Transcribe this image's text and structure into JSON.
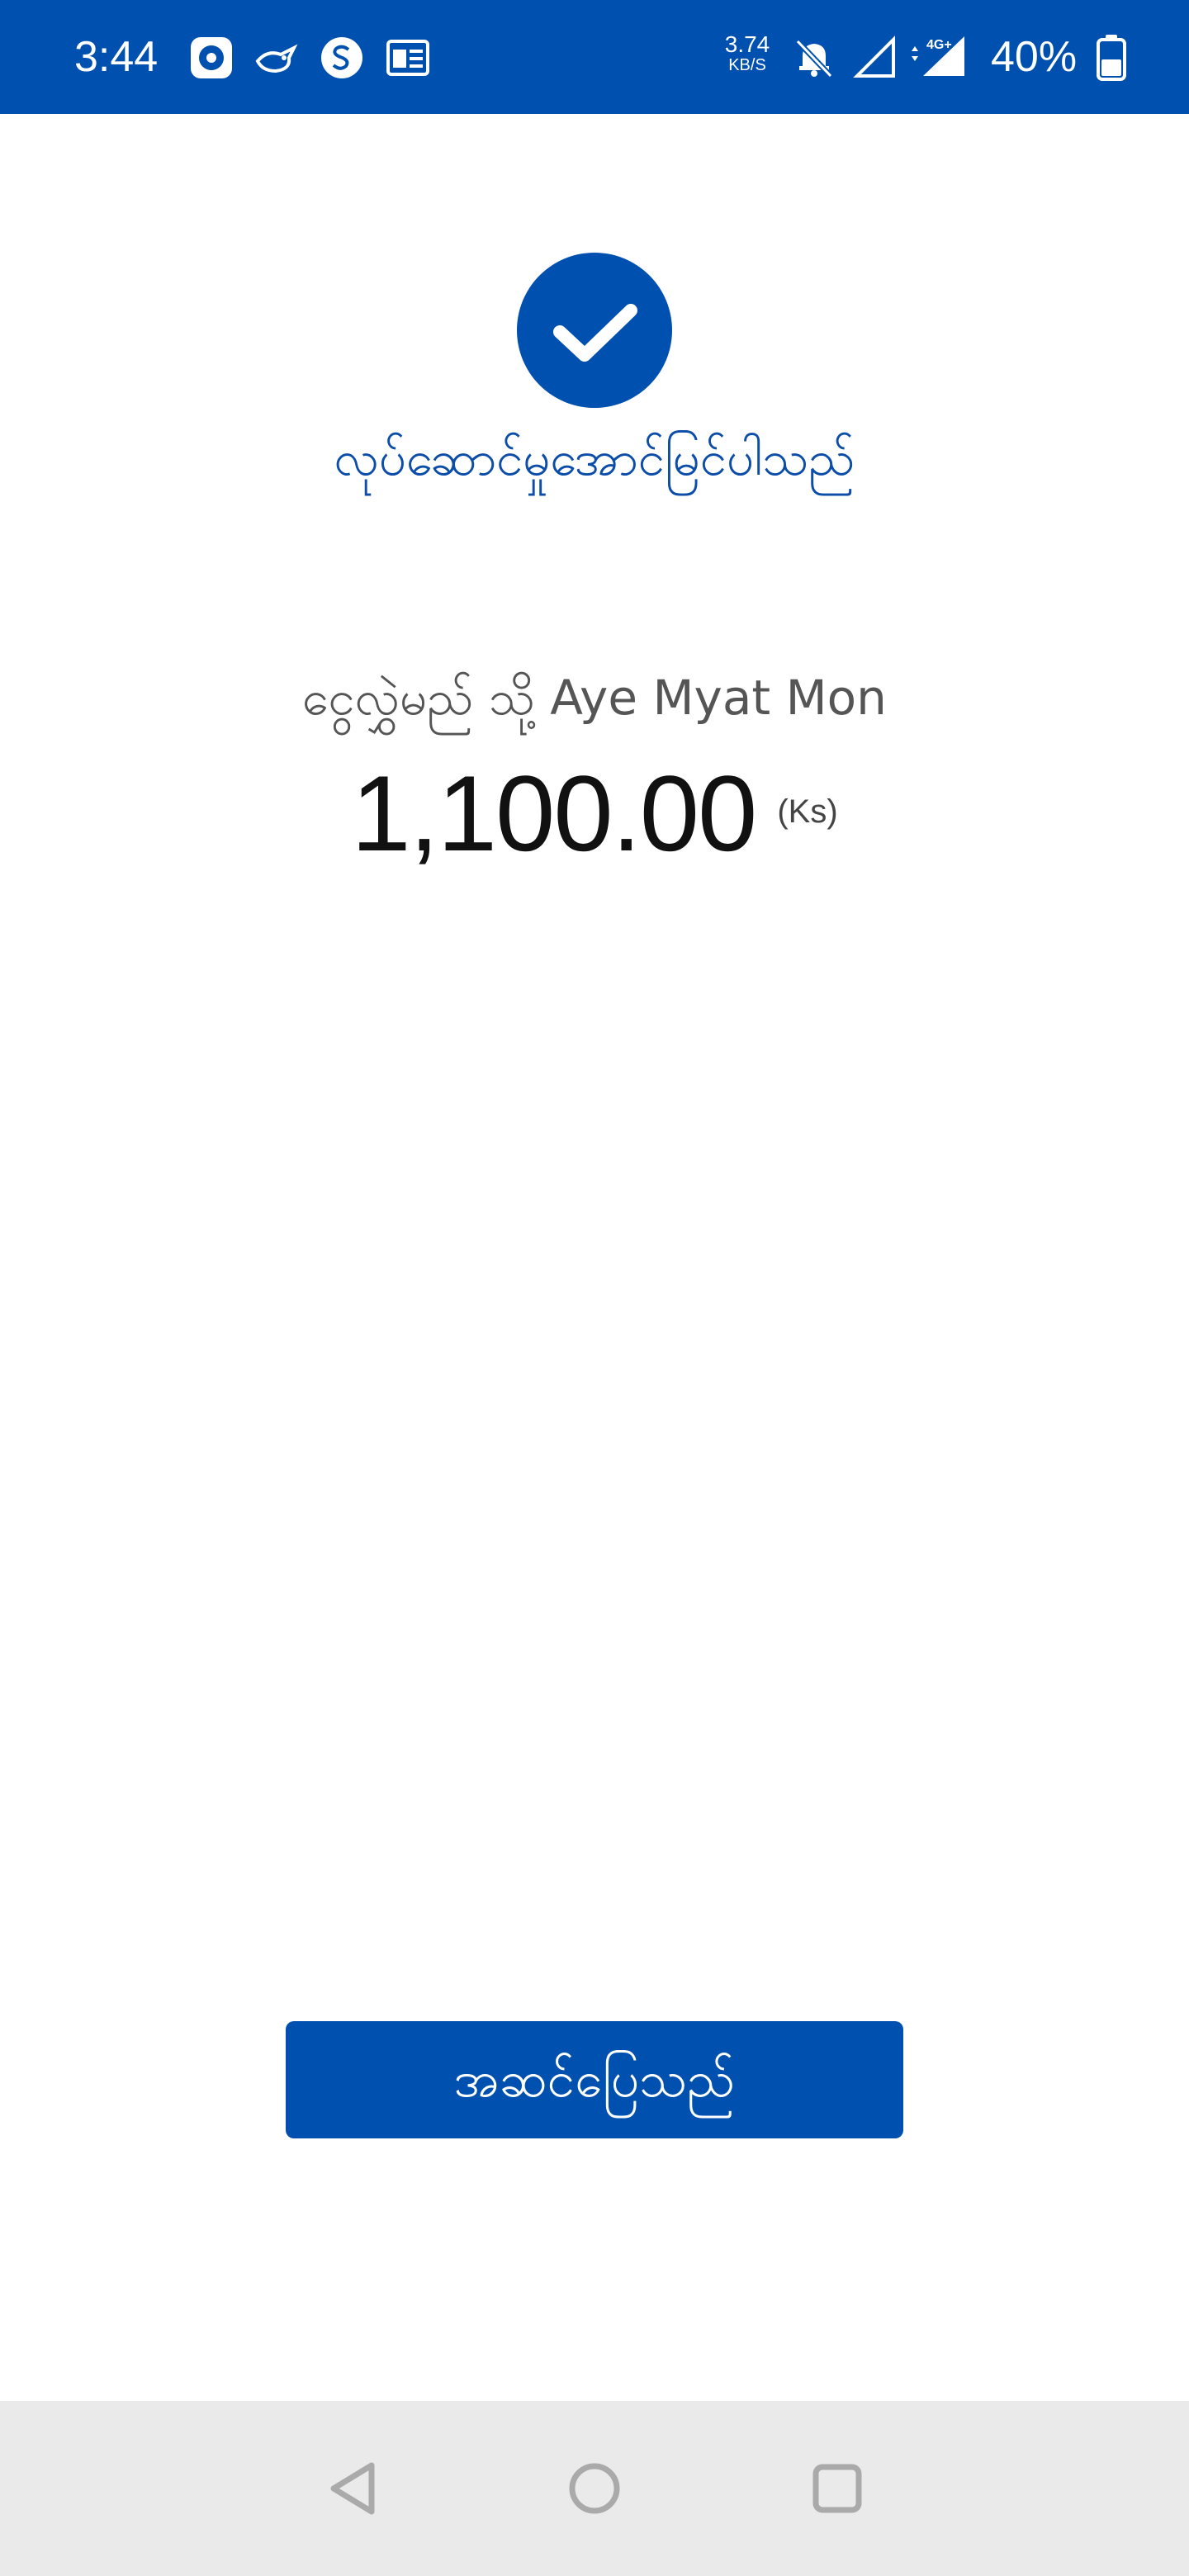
{
  "status_bar": {
    "time": "3:44",
    "net_speed_value": "3.74",
    "net_speed_unit": "KB/S",
    "network_type": "4G+",
    "battery_percent": "40%",
    "icons": [
      "media-icon",
      "bird-icon",
      "s-app-icon",
      "news-icon",
      "bell-off-icon",
      "signal-icon",
      "signal-4g-icon",
      "battery-icon"
    ]
  },
  "success": {
    "title": "လုပ်ဆောင်မှုအောင်မြင်ပါသည်",
    "icon": "check-icon"
  },
  "transfer": {
    "recipient_text": "ငွေလွှဲမည် သို့ Aye Myat Mon",
    "amount": "1,100.00",
    "currency": "(Ks)"
  },
  "actions": {
    "done_label": "အဆင်ပြေသည်"
  },
  "nav_bar": {
    "buttons": [
      "back-icon",
      "home-icon",
      "recents-icon"
    ]
  },
  "colors": {
    "primary": "#0050AF",
    "title_blue": "#0B4DA8",
    "nav_background": "#EAEAEA"
  }
}
